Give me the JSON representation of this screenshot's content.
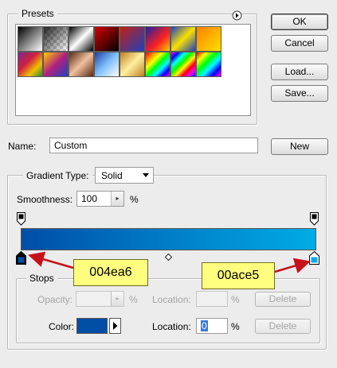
{
  "presets": {
    "title": "Presets",
    "menu_icon": "right-arrow-circle-icon",
    "swatches": [
      "linear-gradient(135deg,#000 0%,#fff 100%)",
      "linear-gradient(135deg,#000 0%,#fff 100%)",
      "linear-gradient(135deg,#000 0%,#fff 50%,#000 100%)",
      "linear-gradient(135deg,#d40000 0%,#000 100%)",
      "linear-gradient(135deg,#c02010 0%,#2040c0 100%)",
      "linear-gradient(135deg,#2020a0 0%,#ff2020 60%,#ffd000 100%)",
      "linear-gradient(135deg,#2040c0 0%,#f8e000 50%,#2040c0 100%)",
      "linear-gradient(135deg,#ff8000 0%,#ffe000 100%)",
      "linear-gradient(135deg,#7a2a8a 0%,#d02040 40%,#f0c000 70%,#2a8a2a 100%)",
      "linear-gradient(135deg,#ffd000 0%,#b02080 50%,#2040c0 100%)",
      "linear-gradient(135deg,#5a2a10 0%,#f0c0a0 50%,#5a2a10 100%)",
      "linear-gradient(135deg,#2040a0 0%,#80c0ff 50%,#ffffff 100%)",
      "linear-gradient(135deg,#c08020 0%,#fff0a0 50%,#c08020 100%)",
      "linear-gradient(135deg,#ff0000,#ff8000,#ffff00,#00ff00,#00ffff,#0000ff,#ff00ff)",
      "linear-gradient(135deg,#ff00ff,#0000ff,#00ffff,#00ff00,#ffff00,#ff0000,#ff00ff,#0000ff)",
      "linear-gradient(135deg,#ff0000,#ffff00,#00ff00,#00ffff,#0000ff,#ff00ff)"
    ]
  },
  "buttons": {
    "ok": "OK",
    "cancel": "Cancel",
    "load": "Load...",
    "save": "Save...",
    "new": "New",
    "delete1": "Delete",
    "delete2": "Delete"
  },
  "name": {
    "label": "Name:",
    "value": "Custom"
  },
  "gradient_type": {
    "title": "Gradient Type:",
    "value": "Solid",
    "chevron_icon": "chevron-down-icon"
  },
  "smoothness": {
    "label": "Smoothness:",
    "value": "100",
    "unit": "%"
  },
  "gradient": {
    "start_color": "#004ea6",
    "end_color": "#00ace5",
    "midpoint": 0.5
  },
  "callouts": {
    "left": "004ea6",
    "right": "00ace5"
  },
  "stops": {
    "title": "Stops",
    "opacity_label": "Opacity:",
    "opacity_value": "",
    "opacity_unit": "%",
    "location1_label": "Location:",
    "location1_value": "",
    "location1_unit": "%",
    "color_label": "Color:",
    "color_swatch": "#004ea6",
    "location2_label": "Location:",
    "location2_value": "0",
    "location2_unit": "%"
  }
}
